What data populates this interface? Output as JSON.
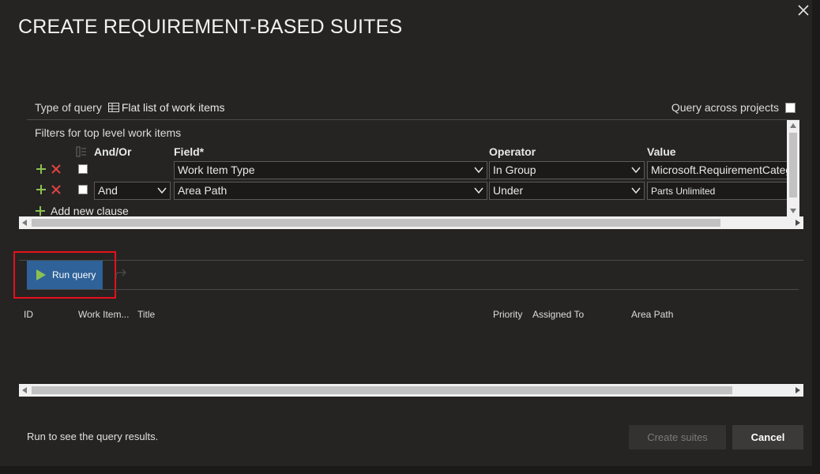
{
  "dialog": {
    "title": "CREATE REQUIREMENT-BASED SUITES"
  },
  "query": {
    "type_label": "Type of query",
    "type_value": "Flat list of work items",
    "across_projects_label": "Query across projects",
    "filters_label": "Filters for top level work items",
    "columns": {
      "and_or": "And/Or",
      "field": "Field*",
      "operator": "Operator",
      "value": "Value"
    },
    "clauses": [
      {
        "and_or": "",
        "field": "Work Item Type",
        "operator": "In Group",
        "value": "Microsoft.RequirementCategory"
      },
      {
        "and_or": "And",
        "field": "Area Path",
        "operator": "Under",
        "value": "Parts Unlimited"
      }
    ],
    "add_clause_label": "Add new clause"
  },
  "toolbar": {
    "run_query_label": "Run query"
  },
  "results": {
    "columns": [
      "ID",
      "Work Item...",
      "Title",
      "Priority",
      "Assigned To",
      "Area Path"
    ]
  },
  "footer": {
    "status": "Run to see the query results.",
    "create_label": "Create suites",
    "cancel_label": "Cancel"
  },
  "colors": {
    "background": "#252423",
    "primary_button": "#2e6299",
    "add_icon": "#8cc152",
    "delete_icon": "#e04343",
    "highlight": "#e8101a"
  }
}
